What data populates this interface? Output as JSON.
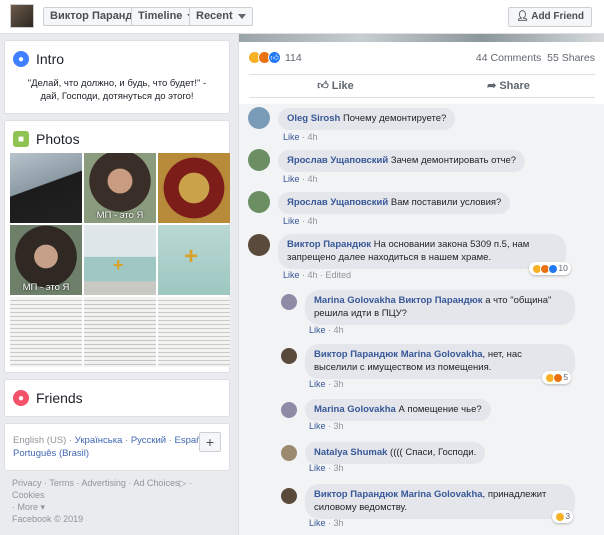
{
  "header": {
    "name": "Виктор Парандюк",
    "timeline": "Timeline",
    "recent": "Recent",
    "add_friend": "Add Friend"
  },
  "intro": {
    "title": "Intro",
    "quote": "\"Делай, что должно, и будь, что будет!\" - дай, Господи, дотянуться до этого!"
  },
  "photos": {
    "title": "Photos",
    "caption1": "МП - это Я",
    "caption2": "МП - это Я"
  },
  "friends": {
    "title": "Friends"
  },
  "languages": {
    "current": "English (US)",
    "l1": "Українська",
    "l2": "Русский",
    "l3": "Español",
    "l4": "Português (Brasil)"
  },
  "footer": {
    "l1": "Privacy",
    "l2": "Terms",
    "l3": "Advertising",
    "l4": "Ad Choices",
    "l5": "Cookies",
    "l6": "More",
    "copyright": "Facebook © 2019"
  },
  "post": {
    "reaction_count": "114",
    "comments": "44 Comments",
    "shares": "55 Shares",
    "like": "Like",
    "share": "Share"
  },
  "comments": [
    {
      "author": "Oleg Sirosh",
      "text": "Почему демонтируете?",
      "like": "Like",
      "time": "4h"
    },
    {
      "author": "Ярослав Ущаповский",
      "text": "Зачем демонтировать отче?",
      "like": "Like",
      "time": "4h"
    },
    {
      "author": "Ярослав Ущаповский",
      "text": "Вам поставили условия?",
      "like": "Like",
      "time": "4h"
    },
    {
      "author": "Виктор Парандюк",
      "text": "На основании закона 5309 п.5, нам запрещено далее находиться в нашем храме.",
      "like": "Like",
      "time": "4h",
      "edited": "Edited",
      "reactions": "10"
    },
    {
      "author": "Marina Golovakha",
      "mention": "Виктор Парандюк",
      "text": "а что \"община\" решила идти в ПЦУ?",
      "like": "Like",
      "time": "4h"
    },
    {
      "author": "Виктор Парандюк",
      "mention": "Marina Golovakha",
      "text": ", нет, нас выселили с имуществом из помещения.",
      "like": "Like",
      "time": "3h",
      "reactions": "5"
    },
    {
      "author": "Marina Golovakha",
      "text": "А помещение чье?",
      "like": "Like",
      "time": "3h"
    },
    {
      "author": "Natalya Shumak",
      "text": "(((( Спаси, Господи.",
      "like": "Like",
      "time": "3h"
    },
    {
      "author": "Виктор Парандюк",
      "mention": "Marina Golovakha",
      "text": ", принадлежит силовому ведомству.",
      "like": "Like",
      "time": "3h",
      "reactions": "3"
    }
  ]
}
